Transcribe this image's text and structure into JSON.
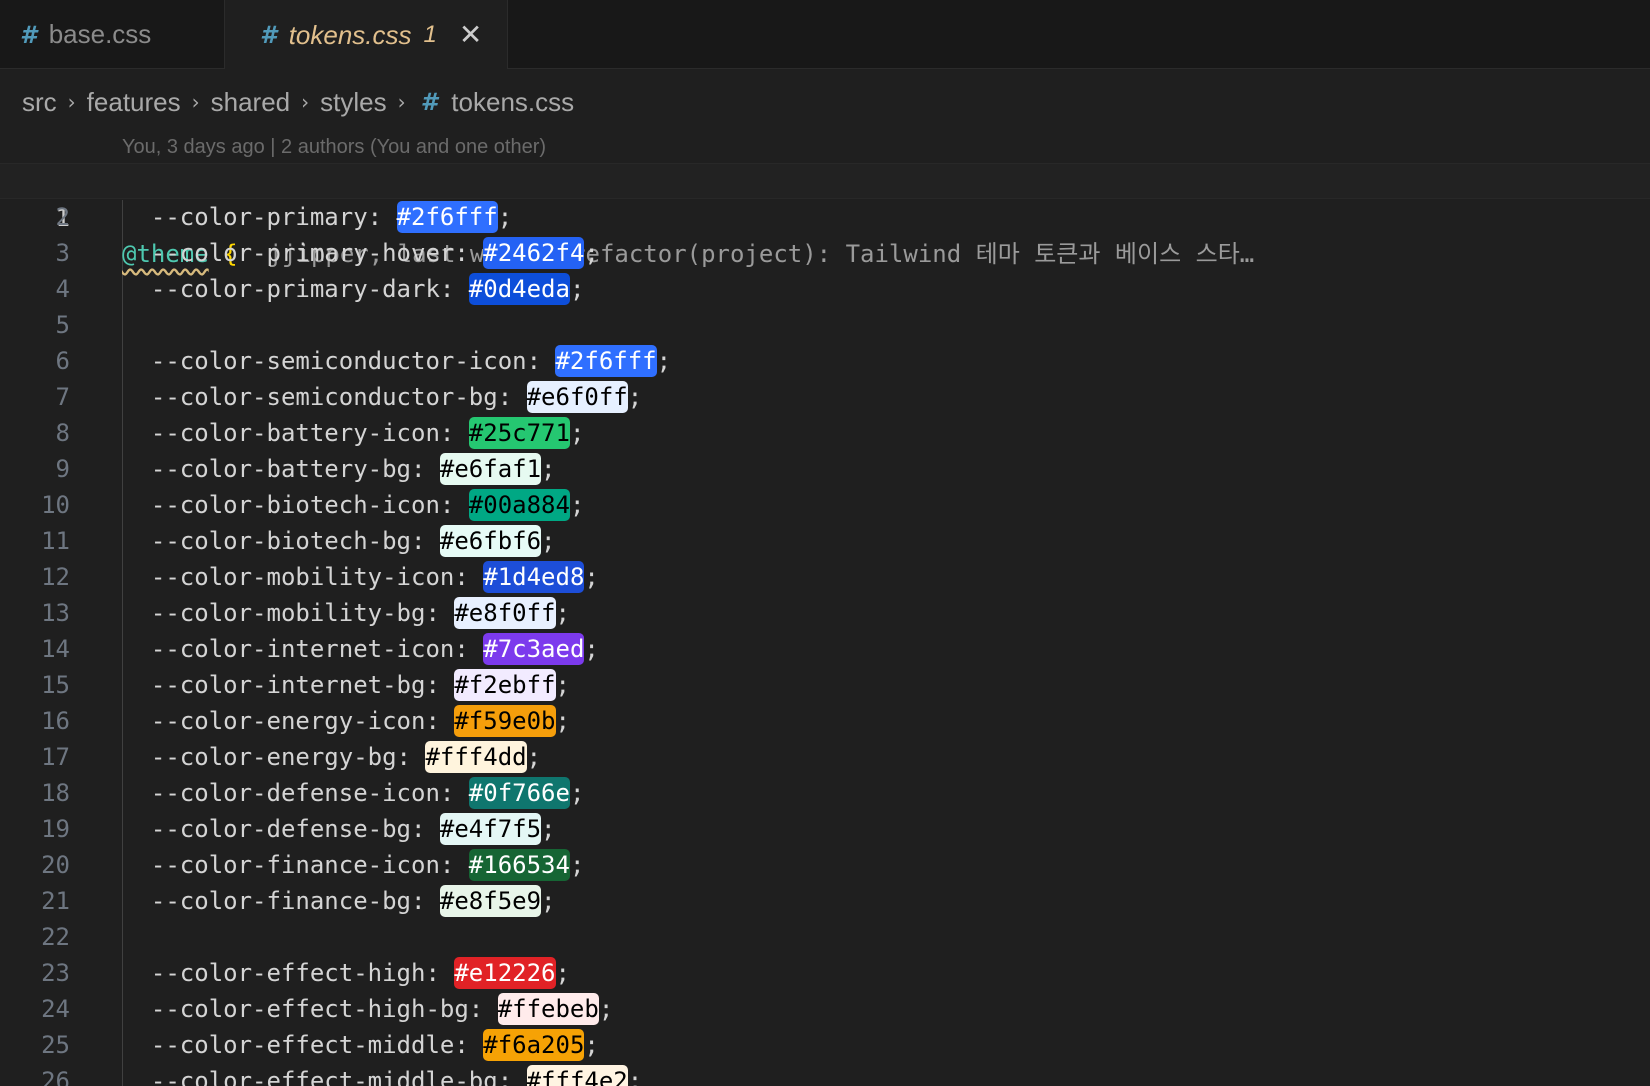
{
  "tabs": [
    {
      "icon": "css-hash-icon",
      "label": "base.css",
      "active": false
    },
    {
      "icon": "css-hash-icon",
      "label": "tokens.css",
      "badge": "1",
      "active": true
    }
  ],
  "icons": {
    "hash": "#",
    "chevron": "›",
    "close": "✕"
  },
  "breadcrumb": [
    "src",
    "features",
    "shared",
    "styles",
    "tokens.css"
  ],
  "blame_header": "You, 3 days ago | 2 authors (You and one other)",
  "first_line": {
    "at_rule": "@theme",
    "brace": "{",
    "blame": "jjipper, last week • refactor(project): Tailwind 테마 토큰과 베이스 스타…"
  },
  "line_numbers": [
    "1",
    "2",
    "3",
    "4",
    "5",
    "6",
    "7",
    "8",
    "9",
    "10",
    "11",
    "12",
    "13",
    "14",
    "15",
    "16",
    "17",
    "18",
    "19",
    "20",
    "21",
    "22",
    "23",
    "24",
    "25",
    "26"
  ],
  "lines": [
    {
      "prop": "--color-primary: ",
      "value": "#2f6fff",
      "text_color": "#ffffff"
    },
    {
      "prop": "--color-primary-hover: ",
      "value": "#2462f4",
      "text_color": "#ffffff"
    },
    {
      "prop": "--color-primary-dark: ",
      "value": "#0d4eda",
      "text_color": "#ffffff"
    },
    null,
    {
      "prop": "--color-semiconductor-icon: ",
      "value": "#2f6fff",
      "text_color": "#ffffff"
    },
    {
      "prop": "--color-semiconductor-bg: ",
      "value": "#e6f0ff",
      "text_color": "#000000"
    },
    {
      "prop": "--color-battery-icon: ",
      "value": "#25c771",
      "text_color": "#000000"
    },
    {
      "prop": "--color-battery-bg: ",
      "value": "#e6faf1",
      "text_color": "#000000"
    },
    {
      "prop": "--color-biotech-icon: ",
      "value": "#00a884",
      "text_color": "#000000"
    },
    {
      "prop": "--color-biotech-bg: ",
      "value": "#e6fbf6",
      "text_color": "#000000"
    },
    {
      "prop": "--color-mobility-icon: ",
      "value": "#1d4ed8",
      "text_color": "#ffffff"
    },
    {
      "prop": "--color-mobility-bg: ",
      "value": "#e8f0ff",
      "text_color": "#000000"
    },
    {
      "prop": "--color-internet-icon: ",
      "value": "#7c3aed",
      "text_color": "#ffffff"
    },
    {
      "prop": "--color-internet-bg: ",
      "value": "#f2ebff",
      "text_color": "#000000"
    },
    {
      "prop": "--color-energy-icon: ",
      "value": "#f59e0b",
      "text_color": "#000000"
    },
    {
      "prop": "--color-energy-bg: ",
      "value": "#fff4dd",
      "text_color": "#000000"
    },
    {
      "prop": "--color-defense-icon: ",
      "value": "#0f766e",
      "text_color": "#ffffff"
    },
    {
      "prop": "--color-defense-bg: ",
      "value": "#e4f7f5",
      "text_color": "#000000"
    },
    {
      "prop": "--color-finance-icon: ",
      "value": "#166534",
      "text_color": "#ffffff"
    },
    {
      "prop": "--color-finance-bg: ",
      "value": "#e8f5e9",
      "text_color": "#000000"
    },
    null,
    {
      "prop": "--color-effect-high: ",
      "value": "#e12226",
      "text_color": "#ffffff"
    },
    {
      "prop": "--color-effect-high-bg: ",
      "value": "#ffebeb",
      "text_color": "#000000"
    },
    {
      "prop": "--color-effect-middle: ",
      "value": "#f6a205",
      "text_color": "#000000"
    },
    {
      "prop": "--color-effect-middle-bg: ",
      "value": "#fff4e2",
      "text_color": "#000000"
    }
  ]
}
